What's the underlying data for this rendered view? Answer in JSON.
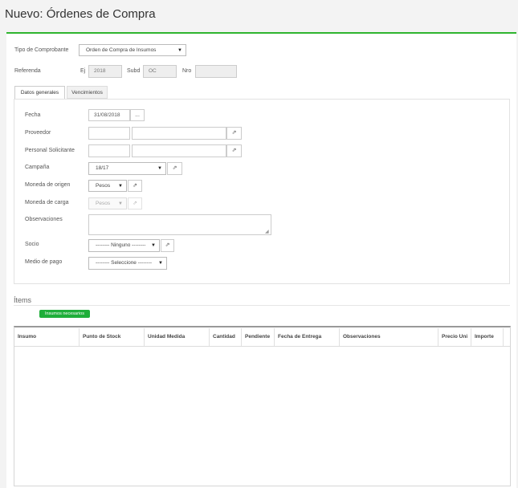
{
  "page": {
    "title": "Nuevo: Órdenes de Compra"
  },
  "header_form": {
    "tipo_label": "Tipo de Comprobante",
    "tipo_value": "Orden de Compra de Insumos",
    "referencia_label": "Referenda",
    "ej_label": "Ej",
    "ej_value": "2018",
    "subd_label": "Subd",
    "subd_value": "OC",
    "nro_label": "Nro",
    "nro_value": ""
  },
  "tabs": [
    {
      "label": "Datos generales",
      "active": true
    },
    {
      "label": "Vencimientos",
      "active": false
    }
  ],
  "form": {
    "fecha": {
      "label": "Fecha",
      "value": "31/08/2018",
      "button": "..."
    },
    "proveedor": {
      "label": "Proveedor",
      "code": "",
      "name": ""
    },
    "personal": {
      "label": "Personal Solicitante",
      "code": "",
      "name": ""
    },
    "campana": {
      "label": "Campaña",
      "value": "18/17"
    },
    "moneda_origen": {
      "label": "Moneda de origen",
      "value": "Pesos"
    },
    "moneda_carga": {
      "label": "Moneda de carga",
      "value": "Pesos"
    },
    "observaciones": {
      "label": "Observaciones",
      "value": ""
    },
    "socio": {
      "label": "Socio",
      "value": "-------- Ninguno --------"
    },
    "medio_pago": {
      "label": "Medio de pago",
      "value": "-------- Seleccione --------"
    }
  },
  "items": {
    "section_label": "Ítems",
    "insumos_button": "Insumos necesarios",
    "columns": [
      "Insumo",
      "Punto de Stock",
      "Unidad Medida",
      "Cantidad",
      "Pendiente",
      "Fecha de Entrega",
      "Observaciones",
      "Precio Uni",
      "Importe"
    ]
  },
  "colors": {
    "accent": "#2fb52f",
    "button_green": "#1fae3a"
  },
  "icons": {
    "external_link": "external-link-icon",
    "caret": "caret-down-icon"
  }
}
